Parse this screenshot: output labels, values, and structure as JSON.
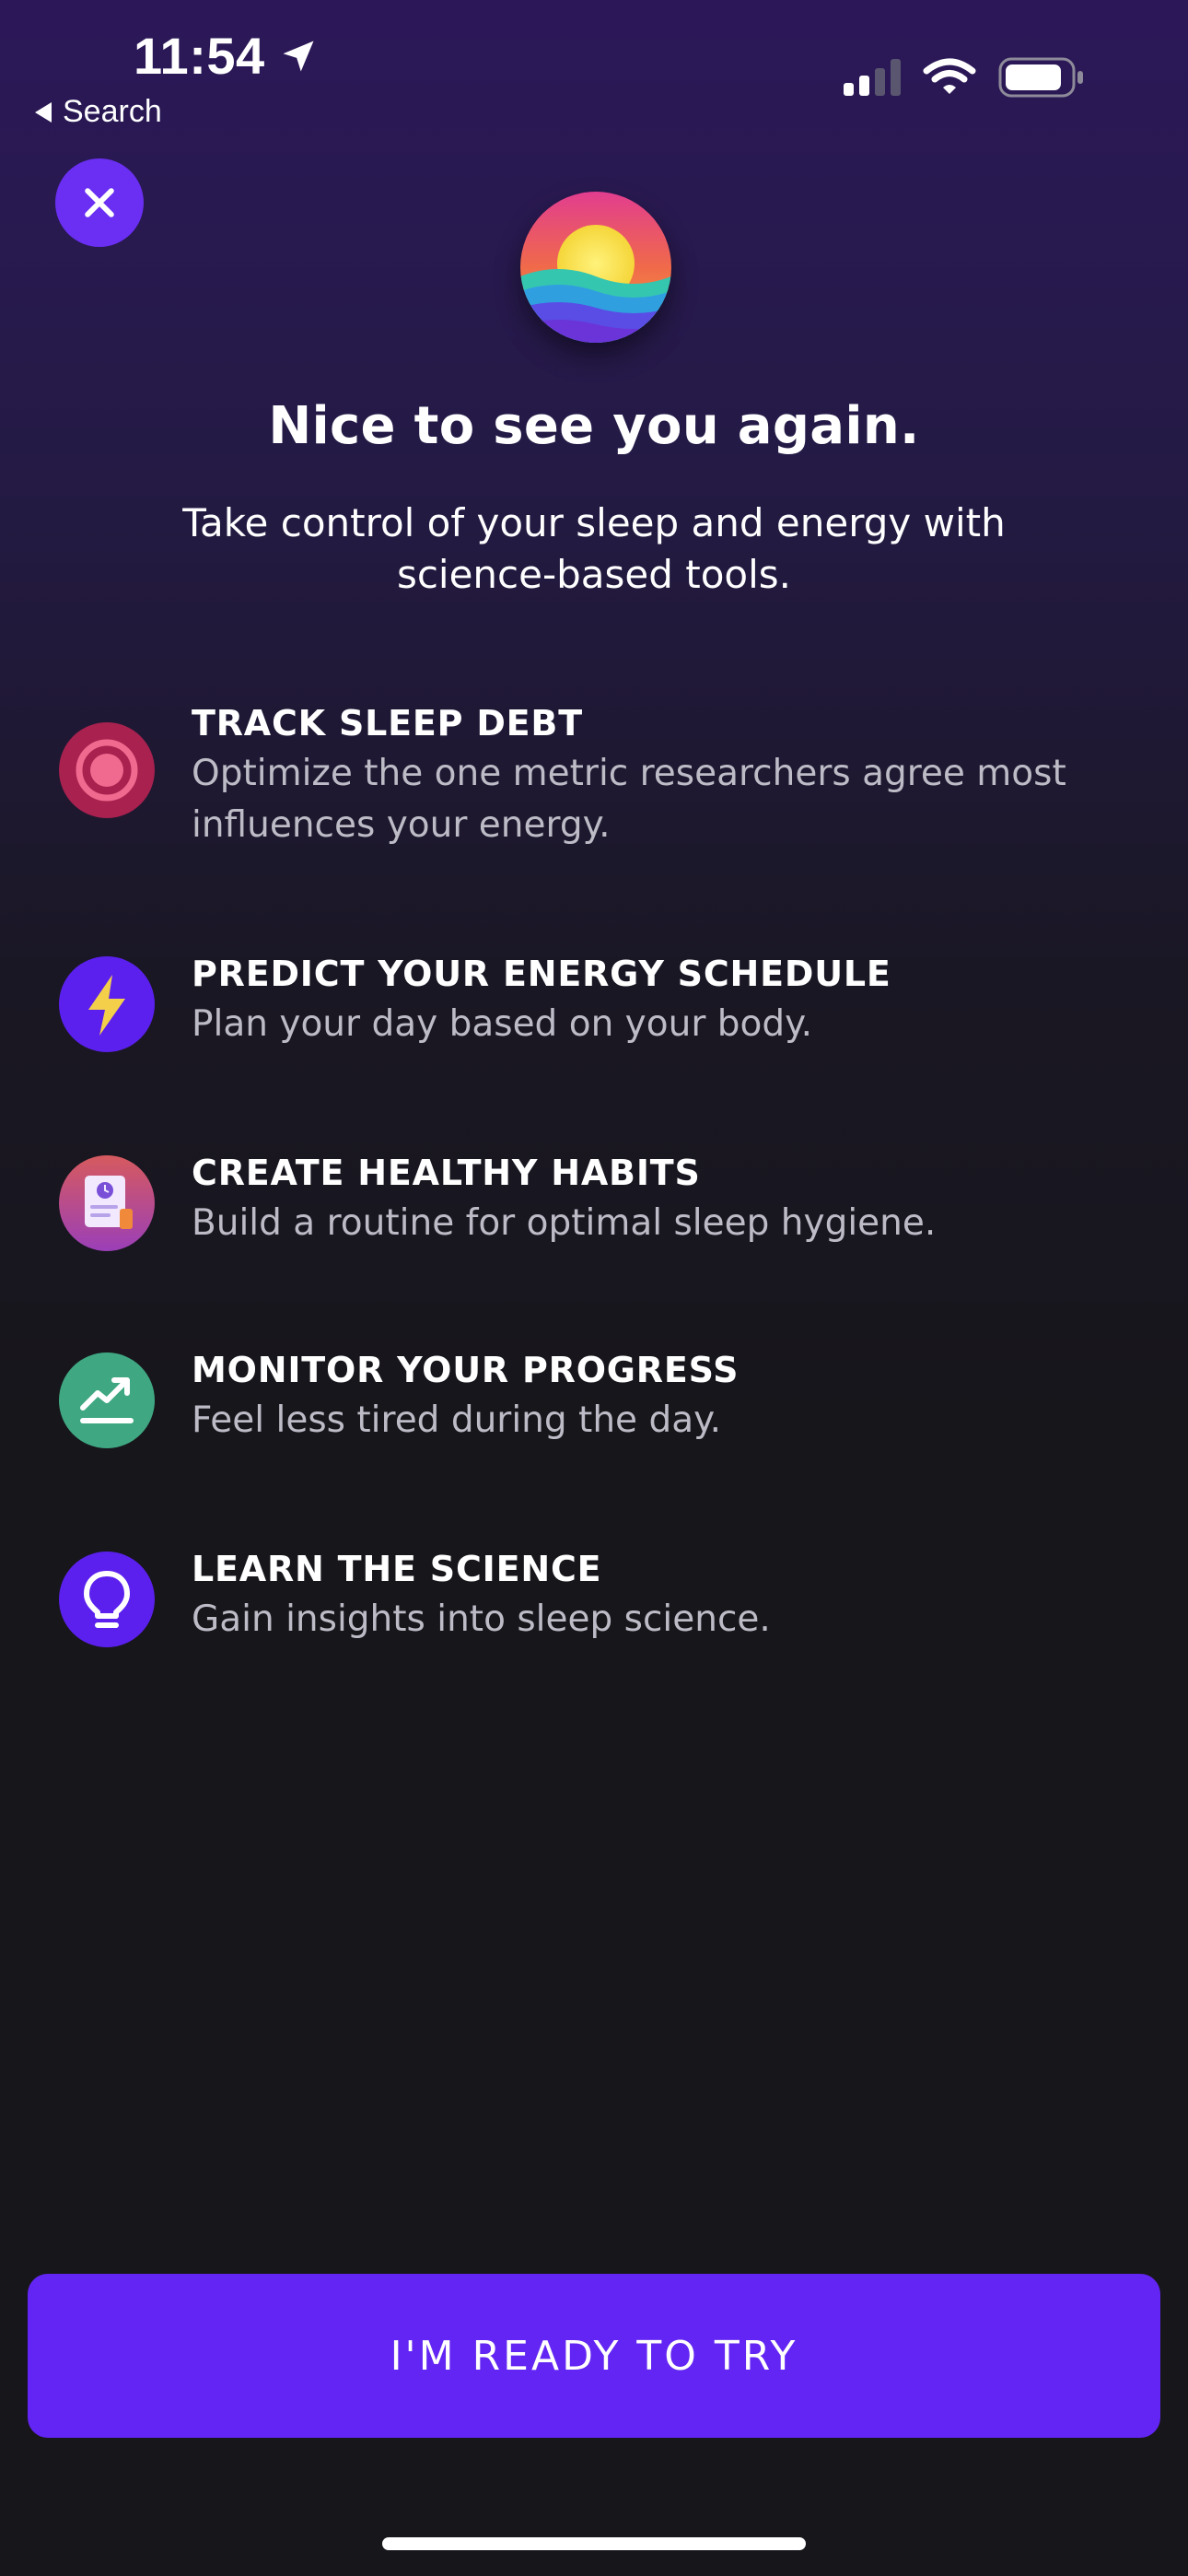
{
  "status_bar": {
    "time": "11:54",
    "back_label": "Search"
  },
  "onboarding": {
    "headline": "Nice to see you again.",
    "subheadline": "Take control of your sleep and energy with science-based tools.",
    "features": [
      {
        "title": "TRACK SLEEP DEBT",
        "description": "Optimize the one metric researchers agree most influences your energy.",
        "icon": "target-icon",
        "color": "#a8214f"
      },
      {
        "title": "PREDICT YOUR ENERGY SCHEDULE",
        "description": "Plan your day based on your body.",
        "icon": "lightning-icon",
        "color": "#5b20ee"
      },
      {
        "title": "CREATE HEALTHY HABITS",
        "description": "Build a routine for optimal sleep hygiene.",
        "icon": "habit-card-icon",
        "color": "#c4566a"
      },
      {
        "title": "MONITOR YOUR PROGRESS",
        "description": "Feel less tired during the day.",
        "icon": "trend-up-icon",
        "color": "#3fa882"
      },
      {
        "title": "LEARN THE SCIENCE",
        "description": "Gain insights into sleep science.",
        "icon": "lightbulb-icon",
        "color": "#5b20ee"
      }
    ],
    "cta_label": "I'M READY TO TRY"
  },
  "colors": {
    "accent": "#6325f3",
    "close_button": "#6a2ff2"
  }
}
